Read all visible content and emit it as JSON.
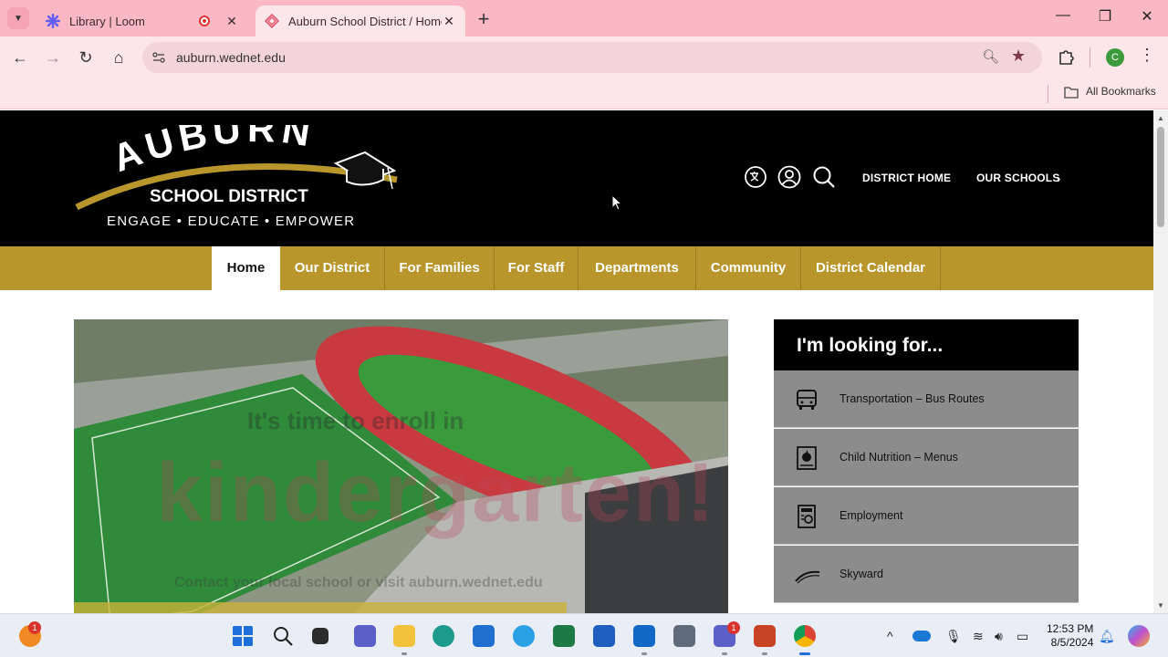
{
  "browser": {
    "tabs": [
      {
        "title": "Library | Loom",
        "recording": true
      },
      {
        "title": "Auburn School District / Homep",
        "active": true
      }
    ],
    "address": "auburn.wednet.edu",
    "profile_initial": "C",
    "bookmarks_label": "All Bookmarks"
  },
  "site": {
    "logo": {
      "word": "AUBURN",
      "subtitle": "SCHOOL DISTRICT",
      "tagline": "ENGAGE • EDUCATE • EMPOWER"
    },
    "header_links": [
      "DISTRICT HOME",
      "OUR SCHOOLS"
    ],
    "header_icons": [
      "translate-icon",
      "user-icon",
      "search-icon"
    ],
    "nav": [
      "Home",
      "Our District",
      "For Families",
      "For Staff",
      "Departments",
      "Community",
      "District Calendar"
    ],
    "active_nav": "Home",
    "hero": {
      "caption": "It's time to enroll in",
      "word": "kindergarten!",
      "sub": "Contact your local school or visit auburn.wednet.edu"
    },
    "looking_for": {
      "title": "I'm looking for...",
      "items": [
        {
          "label": "Transportation – Bus Routes",
          "icon": "bus-icon"
        },
        {
          "label": "Child Nutrition – Menus",
          "icon": "apple-icon"
        },
        {
          "label": "Employment",
          "icon": "jobs-icon"
        },
        {
          "label": "Skyward",
          "icon": "skyward-icon"
        }
      ]
    }
  },
  "taskbar": {
    "notification_count": "1",
    "teams_badge": "1",
    "time": "12:53 PM",
    "date": "8/5/2024"
  },
  "colors": {
    "tab_strip": "#f9b8c4",
    "nav_gold": "#b8962c",
    "header_black": "#000000",
    "panel_gray": "#8c8c8c"
  }
}
